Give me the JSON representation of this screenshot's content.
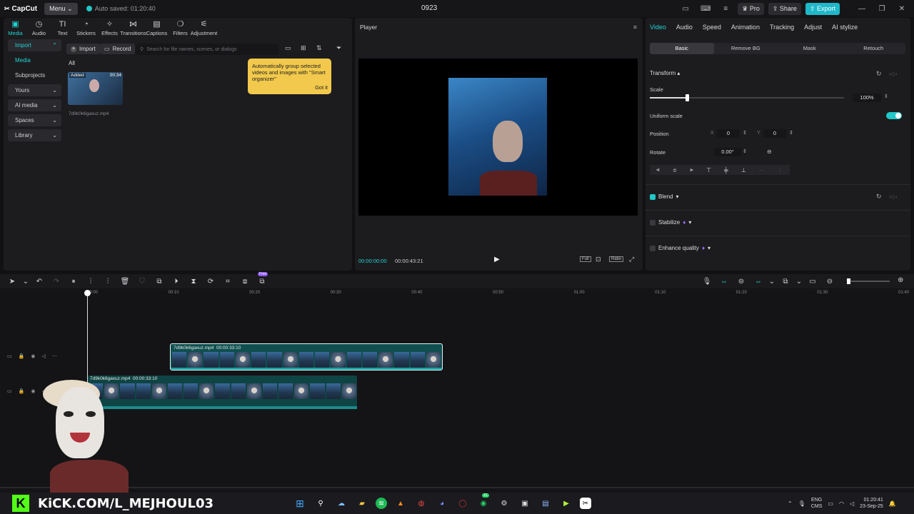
{
  "titlebar": {
    "logo": "CapCut",
    "menu_label": "Menu",
    "autosave": "Auto saved: 01:20:40",
    "project_title": "0923",
    "pro_label": "Pro",
    "share_label": "Share",
    "export_label": "Export"
  },
  "media_tools": [
    {
      "label": "Media",
      "icon": "media-icon",
      "glyph": "▣"
    },
    {
      "label": "Audio",
      "icon": "audio-icon",
      "glyph": "◷"
    },
    {
      "label": "Text",
      "icon": "text-icon",
      "glyph": "TI"
    },
    {
      "label": "Stickers",
      "icon": "stickers-icon",
      "glyph": "◔"
    },
    {
      "label": "Effects",
      "icon": "effects-icon",
      "glyph": "✧"
    },
    {
      "label": "Transitions",
      "icon": "transitions-icon",
      "glyph": "⋈"
    },
    {
      "label": "Captions",
      "icon": "captions-icon",
      "glyph": "▤"
    },
    {
      "label": "Filters",
      "icon": "filters-icon",
      "glyph": "❍"
    },
    {
      "label": "Adjustment",
      "icon": "adjustment-icon",
      "glyph": "⚟"
    }
  ],
  "sidebar": {
    "items": [
      {
        "label": "Import",
        "chev": "⌃"
      },
      {
        "label": "Media",
        "chev": ""
      },
      {
        "label": "Subprojects",
        "chev": ""
      },
      {
        "label": "Yours",
        "chev": "⌄"
      },
      {
        "label": "AI media",
        "chev": "⌄"
      },
      {
        "label": "Spaces",
        "chev": "⌄"
      },
      {
        "label": "Library",
        "chev": "⌄"
      }
    ]
  },
  "media": {
    "import_label": "Import",
    "record_label": "Record",
    "search_placeholder": "Search for file names, scenes, or dialogs",
    "filter_all": "All",
    "thumb_badge": "Added",
    "thumb_duration": "00:34",
    "thumb_name": "7d9k0k6gaxuz.mp4"
  },
  "tooltip": {
    "text": "Automatically group selected videos and images with \"Smart organizer\"",
    "button": "Got it"
  },
  "player": {
    "title": "Player",
    "current_time": "00:00:00:00",
    "total_time": "00:00:43:21",
    "full_label": "Full",
    "ratio_label": "Ratio"
  },
  "properties": {
    "tabs": [
      "Video",
      "Audio",
      "Speed",
      "Animation",
      "Tracking",
      "Adjust",
      "AI stylize"
    ],
    "subtabs": [
      "Basic",
      "Remove BG",
      "Mask",
      "Retouch"
    ],
    "transform_label": "Transform",
    "scale_label": "Scale",
    "scale_value": "100%",
    "scale_fraction": 0.19,
    "uniform_scale_label": "Uniform scale",
    "position_label": "Position",
    "pos_x_label": "X",
    "pos_x": "0",
    "pos_y_label": "Y",
    "pos_y": "0",
    "rotate_label": "Rotate",
    "rotate_value": "0.00°",
    "blend_label": "Blend",
    "stabilize_label": "Stabilize",
    "enhance_label": "Enhance quality"
  },
  "timeline": {
    "ticks": [
      "00:00",
      "00:10",
      "00:20",
      "00:30",
      "00:40",
      "00:50",
      "01:00",
      "01:10",
      "01:20",
      "01:30",
      "01:40"
    ],
    "free_badge": "Free",
    "clip1": {
      "name": "7d9k0k6gaxuz.mp4",
      "duration": "00:00:33:10"
    },
    "clip2": {
      "name": "7d9k0k6gaxuz.mp4",
      "duration": "00:00:33:10"
    }
  },
  "overlay": {
    "kick_text": "KiCK.COM/L_MEJHOUL03",
    "kick_letter": "K"
  },
  "taskbar": {
    "lang1": "ENG",
    "lang2": "CMS",
    "time": "01:20:41",
    "date": "23-Sep-25",
    "badge_count": "31"
  }
}
